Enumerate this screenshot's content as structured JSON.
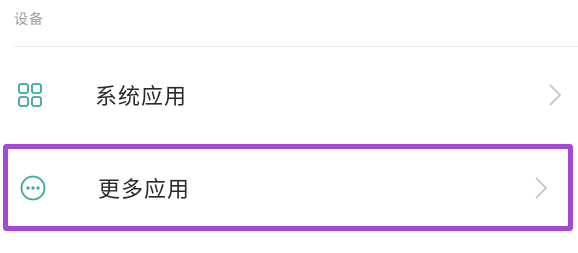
{
  "section": {
    "title": "设备"
  },
  "items": [
    {
      "label": "系统应用",
      "icon": "grid-icon",
      "chevron": "chevron-right-icon"
    },
    {
      "label": "更多应用",
      "icon": "more-horizontal-circle-icon",
      "chevron": "chevron-right-icon",
      "highlighted": true
    }
  ],
  "colors": {
    "icon_accent": "#3aa6a0",
    "highlight_border": "#a449d6",
    "label_text": "#2b2b2b",
    "header_text": "#9a9a9a",
    "chevron": "#c4c4c4"
  }
}
